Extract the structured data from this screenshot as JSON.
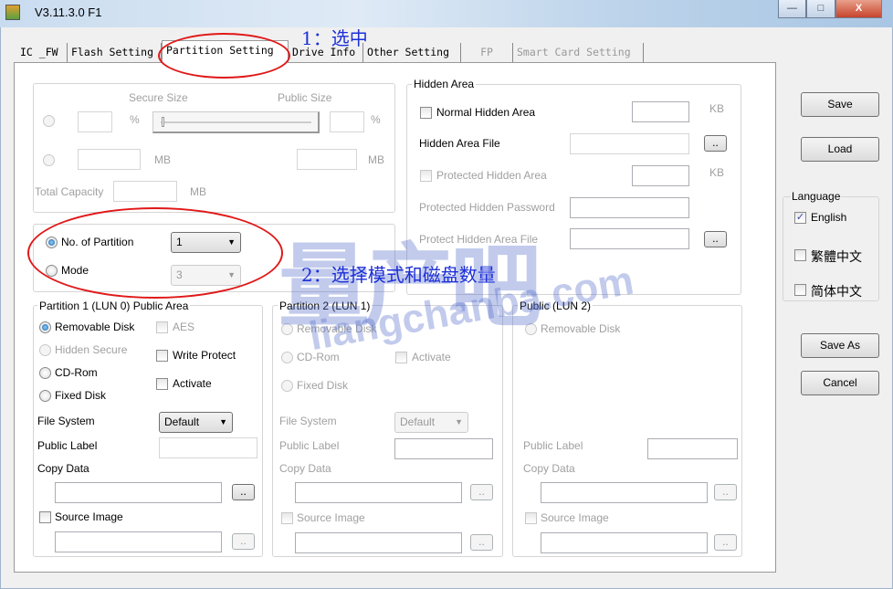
{
  "window": {
    "title": "V3.11.3.0 F1",
    "minimize": "—",
    "maximize": "□",
    "close": "X"
  },
  "tabs": [
    {
      "label": "IC _FW",
      "selected": false,
      "enabled": true
    },
    {
      "label": "Flash Setting",
      "selected": false,
      "enabled": true
    },
    {
      "label": "Partition Setting",
      "selected": true,
      "enabled": true
    },
    {
      "label": "Drive Info",
      "selected": false,
      "enabled": true
    },
    {
      "label": "Other Setting",
      "selected": false,
      "enabled": true
    },
    {
      "label": "FP",
      "selected": false,
      "enabled": false
    },
    {
      "label": "Smart Card Setting",
      "selected": false,
      "enabled": false
    }
  ],
  "annotations": {
    "step1": "1：选中",
    "step2": "2：选择模式和磁盘数量"
  },
  "size": {
    "secure_size": "Secure Size",
    "public_size": "Public Size",
    "percent": "%",
    "mb": "MB",
    "total_capacity": "Total Capacity"
  },
  "partition_mode": {
    "no_of_partition": "No. of Partition",
    "no_of_partition_value": "1",
    "mode": "Mode",
    "mode_value": "3",
    "selected": "no_of_partition"
  },
  "hidden_area": {
    "title": "Hidden Area",
    "normal_hidden_area": "Normal Hidden Area",
    "kb": "KB",
    "hidden_area_file": "Hidden Area File",
    "protected_hidden_area": "Protected Hidden Area",
    "protected_hidden_password": "Protected Hidden Password",
    "protect_hidden_area_file": "Protect Hidden Area File",
    "browse": ".."
  },
  "partition1": {
    "title": "Partition 1 (LUN 0) Public Area",
    "removable_disk": "Removable Disk",
    "hidden_secure": "Hidden Secure",
    "cd_rom": "CD-Rom",
    "fixed_disk": "Fixed Disk",
    "aes": "AES",
    "write_protect": "Write Protect",
    "activate": "Activate",
    "file_system": "File System",
    "file_system_value": "Default",
    "public_label": "Public Label",
    "copy_data": "Copy Data",
    "source_image": "Source Image",
    "browse": ".."
  },
  "partition2": {
    "title": "Partition 2 (LUN 1)",
    "removable_disk": "Removable Disk",
    "cd_rom": "CD-Rom",
    "fixed_disk": "Fixed Disk",
    "activate": "Activate",
    "file_system": "File System",
    "file_system_value": "Default",
    "public_label": "Public Label",
    "copy_data": "Copy Data",
    "source_image": "Source Image",
    "browse": ".."
  },
  "public_lun2": {
    "title": "Public (LUN 2)",
    "removable_disk": "Removable Disk",
    "public_label": "Public Label",
    "copy_data": "Copy Data",
    "source_image": "Source Image",
    "browse": ".."
  },
  "buttons": {
    "save": "Save",
    "load": "Load",
    "save_as": "Save As",
    "cancel": "Cancel"
  },
  "language": {
    "title": "Language",
    "english": "English",
    "traditional": "繁體中文",
    "simplified": "简体中文",
    "checked": "English",
    "check_mark": "✓"
  },
  "watermark": {
    "logo": "量产吧",
    "url": "liangchanba.com"
  },
  "colors": {
    "annotation": "#1d2fd8",
    "highlight_ellipse": "#e01818"
  }
}
